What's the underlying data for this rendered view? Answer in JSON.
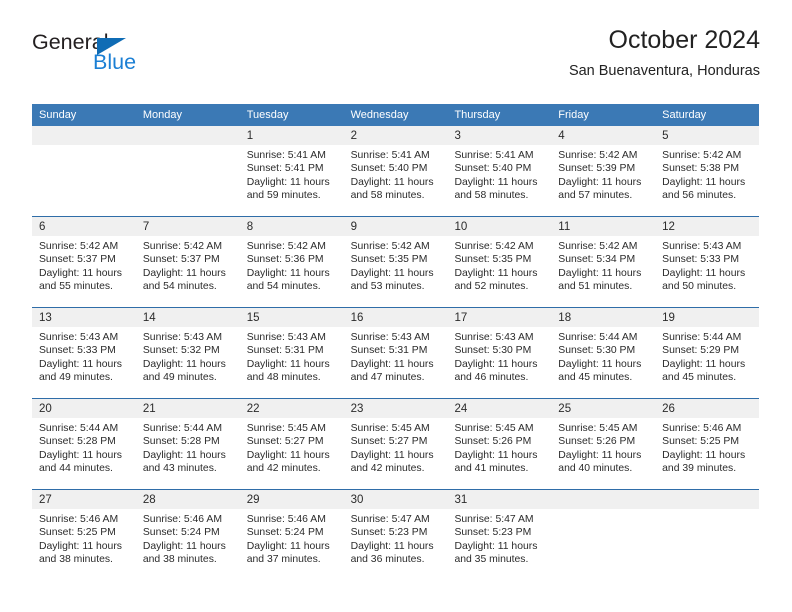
{
  "logo": {
    "primary_text": "General",
    "secondary_text": "Blue",
    "primary_color": "#231f20",
    "secondary_color": "#1b7fd4",
    "triangle_color": "#0f6cb5"
  },
  "header": {
    "title": "October 2024",
    "subtitle": "San Buenaventura, Honduras"
  },
  "theme": {
    "header_bar_color": "#3b79b5",
    "row_divider_color": "#2f6da8",
    "day_strip_color": "#f0f0f0",
    "text_color": "#2b2b2b"
  },
  "weekday_headers": [
    "Sunday",
    "Monday",
    "Tuesday",
    "Wednesday",
    "Thursday",
    "Friday",
    "Saturday"
  ],
  "weeks": [
    [
      {
        "day": "",
        "empty": true,
        "lines": []
      },
      {
        "day": "",
        "empty": true,
        "lines": []
      },
      {
        "day": "1",
        "empty": false,
        "lines": [
          "Sunrise: 5:41 AM",
          "Sunset: 5:41 PM",
          "Daylight: 11 hours",
          "and 59 minutes."
        ]
      },
      {
        "day": "2",
        "empty": false,
        "lines": [
          "Sunrise: 5:41 AM",
          "Sunset: 5:40 PM",
          "Daylight: 11 hours",
          "and 58 minutes."
        ]
      },
      {
        "day": "3",
        "empty": false,
        "lines": [
          "Sunrise: 5:41 AM",
          "Sunset: 5:40 PM",
          "Daylight: 11 hours",
          "and 58 minutes."
        ]
      },
      {
        "day": "4",
        "empty": false,
        "lines": [
          "Sunrise: 5:42 AM",
          "Sunset: 5:39 PM",
          "Daylight: 11 hours",
          "and 57 minutes."
        ]
      },
      {
        "day": "5",
        "empty": false,
        "lines": [
          "Sunrise: 5:42 AM",
          "Sunset: 5:38 PM",
          "Daylight: 11 hours",
          "and 56 minutes."
        ]
      }
    ],
    [
      {
        "day": "6",
        "empty": false,
        "lines": [
          "Sunrise: 5:42 AM",
          "Sunset: 5:37 PM",
          "Daylight: 11 hours",
          "and 55 minutes."
        ]
      },
      {
        "day": "7",
        "empty": false,
        "lines": [
          "Sunrise: 5:42 AM",
          "Sunset: 5:37 PM",
          "Daylight: 11 hours",
          "and 54 minutes."
        ]
      },
      {
        "day": "8",
        "empty": false,
        "lines": [
          "Sunrise: 5:42 AM",
          "Sunset: 5:36 PM",
          "Daylight: 11 hours",
          "and 54 minutes."
        ]
      },
      {
        "day": "9",
        "empty": false,
        "lines": [
          "Sunrise: 5:42 AM",
          "Sunset: 5:35 PM",
          "Daylight: 11 hours",
          "and 53 minutes."
        ]
      },
      {
        "day": "10",
        "empty": false,
        "lines": [
          "Sunrise: 5:42 AM",
          "Sunset: 5:35 PM",
          "Daylight: 11 hours",
          "and 52 minutes."
        ]
      },
      {
        "day": "11",
        "empty": false,
        "lines": [
          "Sunrise: 5:42 AM",
          "Sunset: 5:34 PM",
          "Daylight: 11 hours",
          "and 51 minutes."
        ]
      },
      {
        "day": "12",
        "empty": false,
        "lines": [
          "Sunrise: 5:43 AM",
          "Sunset: 5:33 PM",
          "Daylight: 11 hours",
          "and 50 minutes."
        ]
      }
    ],
    [
      {
        "day": "13",
        "empty": false,
        "lines": [
          "Sunrise: 5:43 AM",
          "Sunset: 5:33 PM",
          "Daylight: 11 hours",
          "and 49 minutes."
        ]
      },
      {
        "day": "14",
        "empty": false,
        "lines": [
          "Sunrise: 5:43 AM",
          "Sunset: 5:32 PM",
          "Daylight: 11 hours",
          "and 49 minutes."
        ]
      },
      {
        "day": "15",
        "empty": false,
        "lines": [
          "Sunrise: 5:43 AM",
          "Sunset: 5:31 PM",
          "Daylight: 11 hours",
          "and 48 minutes."
        ]
      },
      {
        "day": "16",
        "empty": false,
        "lines": [
          "Sunrise: 5:43 AM",
          "Sunset: 5:31 PM",
          "Daylight: 11 hours",
          "and 47 minutes."
        ]
      },
      {
        "day": "17",
        "empty": false,
        "lines": [
          "Sunrise: 5:43 AM",
          "Sunset: 5:30 PM",
          "Daylight: 11 hours",
          "and 46 minutes."
        ]
      },
      {
        "day": "18",
        "empty": false,
        "lines": [
          "Sunrise: 5:44 AM",
          "Sunset: 5:30 PM",
          "Daylight: 11 hours",
          "and 45 minutes."
        ]
      },
      {
        "day": "19",
        "empty": false,
        "lines": [
          "Sunrise: 5:44 AM",
          "Sunset: 5:29 PM",
          "Daylight: 11 hours",
          "and 45 minutes."
        ]
      }
    ],
    [
      {
        "day": "20",
        "empty": false,
        "lines": [
          "Sunrise: 5:44 AM",
          "Sunset: 5:28 PM",
          "Daylight: 11 hours",
          "and 44 minutes."
        ]
      },
      {
        "day": "21",
        "empty": false,
        "lines": [
          "Sunrise: 5:44 AM",
          "Sunset: 5:28 PM",
          "Daylight: 11 hours",
          "and 43 minutes."
        ]
      },
      {
        "day": "22",
        "empty": false,
        "lines": [
          "Sunrise: 5:45 AM",
          "Sunset: 5:27 PM",
          "Daylight: 11 hours",
          "and 42 minutes."
        ]
      },
      {
        "day": "23",
        "empty": false,
        "lines": [
          "Sunrise: 5:45 AM",
          "Sunset: 5:27 PM",
          "Daylight: 11 hours",
          "and 42 minutes."
        ]
      },
      {
        "day": "24",
        "empty": false,
        "lines": [
          "Sunrise: 5:45 AM",
          "Sunset: 5:26 PM",
          "Daylight: 11 hours",
          "and 41 minutes."
        ]
      },
      {
        "day": "25",
        "empty": false,
        "lines": [
          "Sunrise: 5:45 AM",
          "Sunset: 5:26 PM",
          "Daylight: 11 hours",
          "and 40 minutes."
        ]
      },
      {
        "day": "26",
        "empty": false,
        "lines": [
          "Sunrise: 5:46 AM",
          "Sunset: 5:25 PM",
          "Daylight: 11 hours",
          "and 39 minutes."
        ]
      }
    ],
    [
      {
        "day": "27",
        "empty": false,
        "lines": [
          "Sunrise: 5:46 AM",
          "Sunset: 5:25 PM",
          "Daylight: 11 hours",
          "and 38 minutes."
        ]
      },
      {
        "day": "28",
        "empty": false,
        "lines": [
          "Sunrise: 5:46 AM",
          "Sunset: 5:24 PM",
          "Daylight: 11 hours",
          "and 38 minutes."
        ]
      },
      {
        "day": "29",
        "empty": false,
        "lines": [
          "Sunrise: 5:46 AM",
          "Sunset: 5:24 PM",
          "Daylight: 11 hours",
          "and 37 minutes."
        ]
      },
      {
        "day": "30",
        "empty": false,
        "lines": [
          "Sunrise: 5:47 AM",
          "Sunset: 5:23 PM",
          "Daylight: 11 hours",
          "and 36 minutes."
        ]
      },
      {
        "day": "31",
        "empty": false,
        "lines": [
          "Sunrise: 5:47 AM",
          "Sunset: 5:23 PM",
          "Daylight: 11 hours",
          "and 35 minutes."
        ]
      },
      {
        "day": "",
        "empty": true,
        "lines": []
      },
      {
        "day": "",
        "empty": true,
        "lines": []
      }
    ]
  ]
}
